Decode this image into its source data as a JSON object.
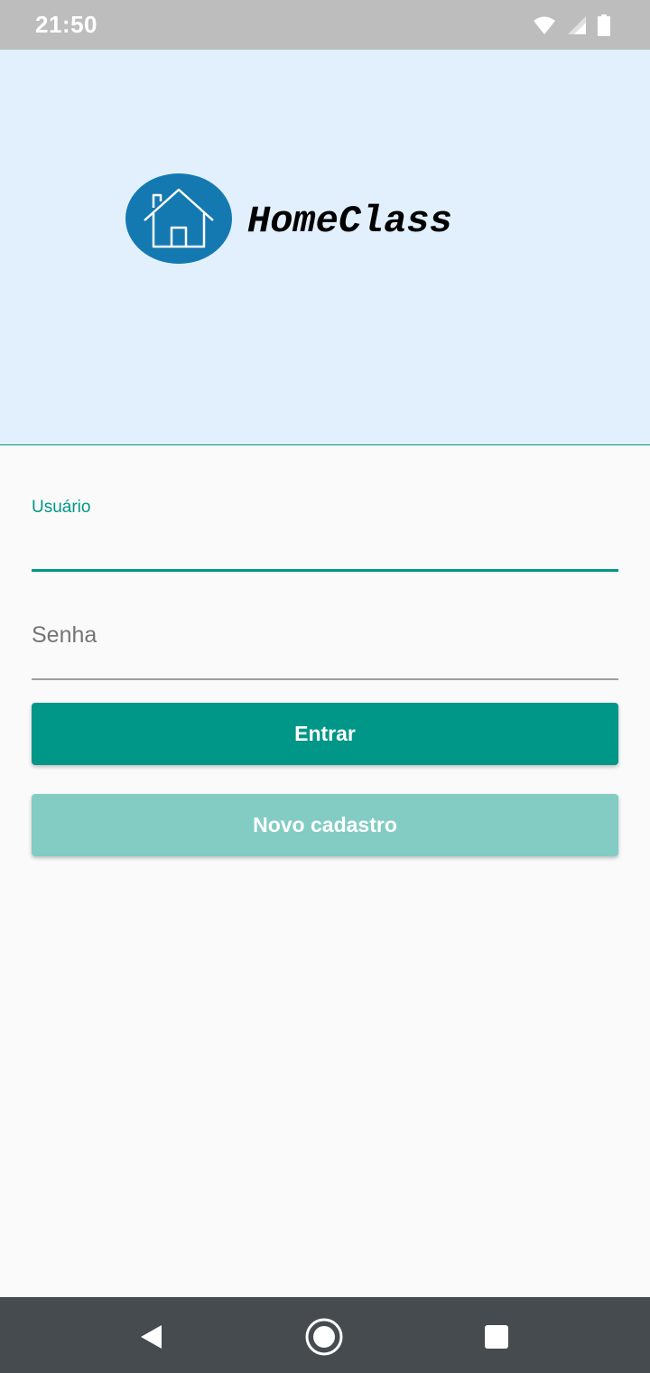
{
  "status_bar": {
    "time": "21:50",
    "icons": [
      "wifi-icon",
      "signal-icon",
      "battery-icon"
    ]
  },
  "header": {
    "logo_icon": "house-icon",
    "app_name": "HomeClass",
    "background_color": "#e1f0fc",
    "logo_color": "#1479b1"
  },
  "form": {
    "username": {
      "label": "Usuário",
      "value": ""
    },
    "password": {
      "placeholder": "Senha",
      "value": ""
    }
  },
  "buttons": {
    "login_label": "Entrar",
    "register_label": "Novo cadastro"
  },
  "colors": {
    "accent": "#009688",
    "accent_light": "#82ccc4",
    "status_bar": "#bdbdbd",
    "nav_bar": "#464b50"
  },
  "nav_bar": {
    "buttons": [
      "back-icon",
      "home-icon",
      "recents-icon"
    ]
  }
}
